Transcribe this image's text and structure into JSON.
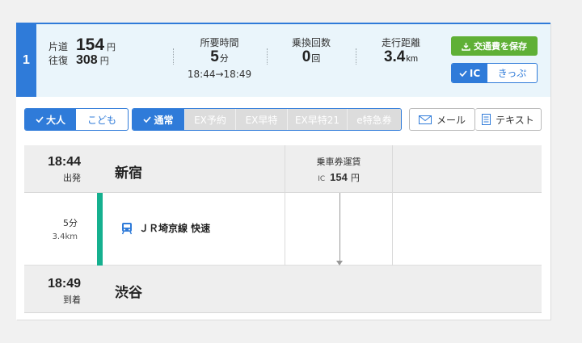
{
  "route": {
    "number": "1",
    "fare": {
      "oneway_label": "片道",
      "oneway_value": "154",
      "oneway_unit": "円",
      "round_label": "往復",
      "round_value": "308",
      "round_unit": "円"
    },
    "time": {
      "caption": "所要時間",
      "value": "5",
      "unit": "分",
      "span": "18:44→18:49"
    },
    "transfers": {
      "caption": "乗換回数",
      "value": "0",
      "unit": "回"
    },
    "distance": {
      "caption": "走行距離",
      "value": "3.4",
      "unit": "km"
    },
    "save_label": "交通費を保存",
    "ic_label": "IC",
    "ticket_label": "きっぷ"
  },
  "toolbar": {
    "passenger": {
      "adult": "大人",
      "child": "こども"
    },
    "fare_type": [
      "通常",
      "EX予約",
      "EX早特",
      "EX早特21",
      "e特急券"
    ],
    "mail_label": "メール",
    "text_label": "テキスト"
  },
  "timetable": {
    "depart": {
      "time": "18:44",
      "label": "出発",
      "station": "新宿"
    },
    "fare": {
      "caption": "乗車券運賃",
      "ic": "IC",
      "value": "154",
      "unit": "円"
    },
    "segment": {
      "duration": "5分",
      "distance": "3.4km",
      "line": "ＪＲ埼京線 快速",
      "line_color": "#15b08f"
    },
    "arrive": {
      "time": "18:49",
      "label": "到着",
      "station": "渋谷"
    }
  },
  "colors": {
    "accent": "#2f7bd9",
    "save": "#5fb036",
    "summary_bg": "#eaf5fb"
  }
}
